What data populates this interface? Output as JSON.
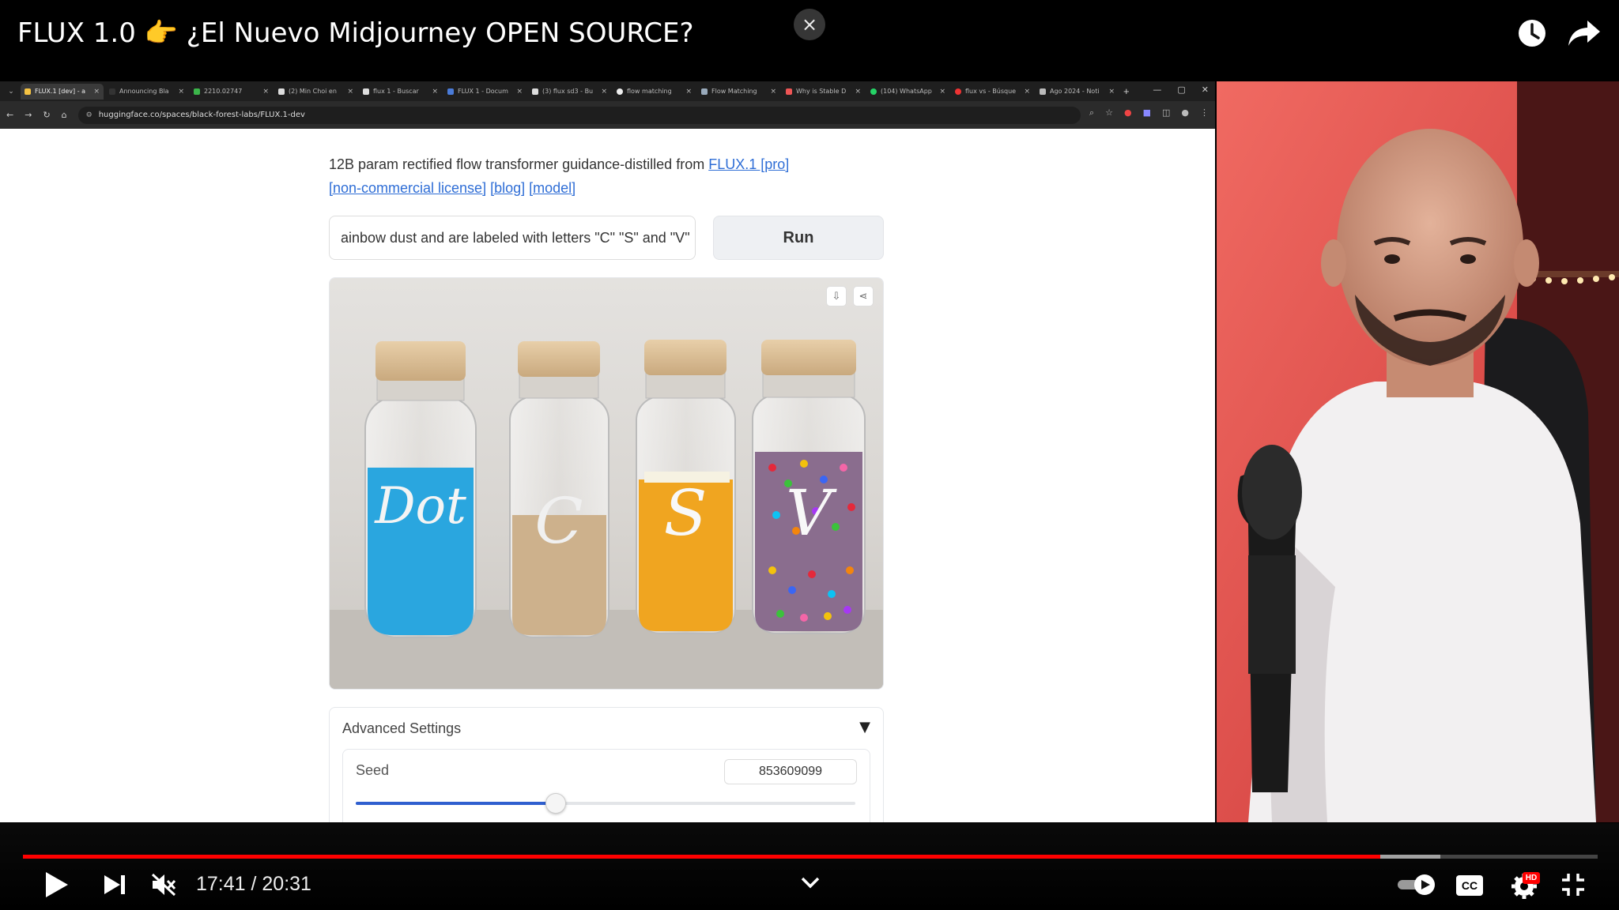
{
  "video": {
    "title": "FLUX 1.0 👉 ¿El Nuevo Midjourney OPEN SOURCE?",
    "close_symbol": "×"
  },
  "browser": {
    "tabs": [
      {
        "label": "FLUX.1 [dev] - a",
        "active": true
      },
      {
        "label": "Announcing Bla",
        "active": false
      },
      {
        "label": "2210.02747",
        "active": false
      },
      {
        "label": "(2) Min Choi en",
        "active": false
      },
      {
        "label": "flux 1 - Buscar",
        "active": false
      },
      {
        "label": "FLUX 1 - Docum",
        "active": false
      },
      {
        "label": "(3) flux sd3 - Bu",
        "active": false
      },
      {
        "label": "flow matching",
        "active": false
      },
      {
        "label": "Flow Matching",
        "active": false
      },
      {
        "label": "Why is Stable D",
        "active": false
      },
      {
        "label": "(104) WhatsApp",
        "active": false
      },
      {
        "label": "flux vs - Búsque",
        "active": false
      },
      {
        "label": "Ago 2024 - Noti",
        "active": false
      }
    ],
    "url": "huggingface.co/spaces/black-forest-labs/FLUX.1-dev"
  },
  "page": {
    "description_text": "12B param rectified flow transformer guidance-distilled from ",
    "link_flux": "FLUX.1 [pro]",
    "link_license": "[non-commercial license]",
    "link_blog": "[blog]",
    "link_model": "[model]",
    "prompt_value": "ainbow dust and are labeled with letters \"C\" \"S\" and \"V\"",
    "run_label": "Run",
    "advanced_label": "Advanced Settings",
    "advanced_toggle": "▼",
    "seed_label": "Seed",
    "seed_value": "853609099",
    "seed_fraction": 0.4
  },
  "player": {
    "current_time": "17:41",
    "duration": "20:31",
    "time_display": "17:41 / 20:31",
    "played_fraction": 0.862,
    "buffered_fraction": 0.9,
    "hd_badge": "HD",
    "cc_label": "CC"
  }
}
